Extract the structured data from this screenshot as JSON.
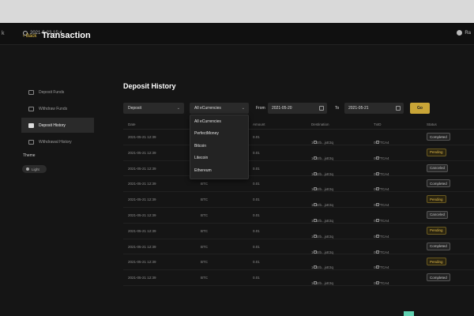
{
  "topbar": {
    "left_glyph": "k",
    "datetime": "2021-5-23 15:4",
    "user": "Ra"
  },
  "back_label": "Back",
  "page_title": "Transaction",
  "sidebar": {
    "items": [
      {
        "label": "Deposit Funds",
        "icon": "deposit-icon"
      },
      {
        "label": "Withdraw Funds",
        "icon": "withdraw-icon"
      },
      {
        "label": "Deposit History",
        "icon": "history-icon",
        "active": true
      },
      {
        "label": "Withdrawal History",
        "icon": "withdraw-history-icon"
      }
    ],
    "theme_label": "Theme",
    "theme_value": "Light"
  },
  "section_title": "Deposit History",
  "filters": {
    "type_value": "Deposit",
    "currency_value": "All eCurrencies",
    "from_label": "From",
    "from_value": "2021-05-20",
    "to_label": "To",
    "to_value": "2021-05-21",
    "go_label": "Go"
  },
  "currency_options": [
    "All eCurrencies",
    "PerfectMoney",
    "Bitcoin",
    "Litecoin",
    "Ethereum"
  ],
  "table": {
    "headers": [
      "Date",
      "Amount",
      "Destination",
      "TxID",
      "Status"
    ],
    "rows": [
      {
        "date": "2021-05-21 12:39",
        "cur": "",
        "amount": "0.01",
        "dest": "1C3zb...jxE3q",
        "txid": "0FTTCA4",
        "status": "Completed",
        "kind": "completed"
      },
      {
        "date": "2021-05-21 12:39",
        "cur": "",
        "amount": "0.01",
        "dest": "1C3zb...jxE3q",
        "txid": "0FTTCA4",
        "status": "Pending",
        "kind": "pending"
      },
      {
        "date": "2021-05-21 12:39",
        "cur": "",
        "amount": "0.01",
        "dest": "1C3zb...jxE3q",
        "txid": "0FTTCA4",
        "status": "Canceled",
        "kind": "canceled"
      },
      {
        "date": "2021-05-21 12:39",
        "cur": "BTC",
        "amount": "0.01",
        "dest": "1C3zb...jxE3q",
        "txid": "0FTTCA4",
        "status": "Completed",
        "kind": "completed"
      },
      {
        "date": "2021-05-21 12:39",
        "cur": "BTC",
        "amount": "0.01",
        "dest": "1C3zb...jxE3q",
        "txid": "0FTTCA4",
        "status": "Pending",
        "kind": "pending"
      },
      {
        "date": "2021-05-21 12:39",
        "cur": "BTC",
        "amount": "0.01",
        "dest": "1C3zb...jxE3q",
        "txid": "0FTTCA4",
        "status": "Canceled",
        "kind": "canceled"
      },
      {
        "date": "2021-05-21 12:39",
        "cur": "BTC",
        "amount": "0.01",
        "dest": "1C3zb...jxE3q",
        "txid": "0FTTCA4",
        "status": "Pending",
        "kind": "pending"
      },
      {
        "date": "2021-05-21 12:39",
        "cur": "BTC",
        "amount": "0.01",
        "dest": "1C3zb...jxE3q",
        "txid": "0FTTCA4",
        "status": "Completed",
        "kind": "completed"
      },
      {
        "date": "2021-05-21 12:39",
        "cur": "BTC",
        "amount": "0.01",
        "dest": "1C3zb...jxE3q",
        "txid": "0FTTCA4",
        "status": "Pending",
        "kind": "pending"
      },
      {
        "date": "2021-05-21 12:39",
        "cur": "BTC",
        "amount": "0.01",
        "dest": "1C3zb...jxE3q",
        "txid": "0FTTCA4",
        "status": "Completed",
        "kind": "completed"
      }
    ]
  },
  "colors": {
    "accent": "#c9a537",
    "background": "#151515",
    "pending": "#e0b94a"
  }
}
